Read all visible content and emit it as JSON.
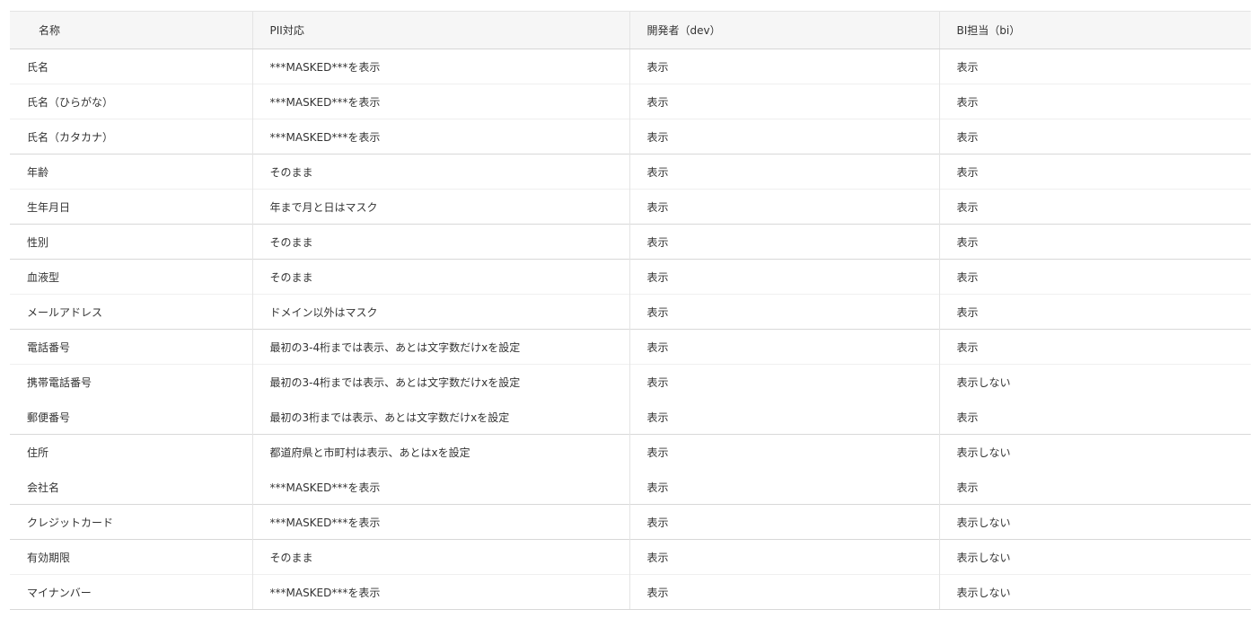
{
  "table": {
    "headers": [
      "名称",
      "PII対応",
      "開発者（dev）",
      "BI担当（bi）"
    ],
    "rows": [
      {
        "name": "氏名",
        "pii": "***MASKED***を表示",
        "dev": "表示",
        "bi": "表示",
        "sep": "strong"
      },
      {
        "name": "氏名（ひらがな）",
        "pii": "***MASKED***を表示",
        "dev": "表示",
        "bi": "表示",
        "sep": "light"
      },
      {
        "name": "氏名（カタカナ）",
        "pii": "***MASKED***を表示",
        "dev": "表示",
        "bi": "表示",
        "sep": "light"
      },
      {
        "name": "年齢",
        "pii": "そのまま",
        "dev": "表示",
        "bi": "表示",
        "sep": "strong"
      },
      {
        "name": "生年月日",
        "pii": "年まで月と日はマスク",
        "dev": "表示",
        "bi": "表示",
        "sep": "light"
      },
      {
        "name": "性別",
        "pii": "そのまま",
        "dev": "表示",
        "bi": "表示",
        "sep": "strong"
      },
      {
        "name": "血液型",
        "pii": "そのまま",
        "dev": "表示",
        "bi": "表示",
        "sep": "strong"
      },
      {
        "name": "メールアドレス",
        "pii": "ドメイン以外はマスク",
        "dev": "表示",
        "bi": "表示",
        "sep": "light"
      },
      {
        "name": "電話番号",
        "pii": "最初の3-4桁までは表示、あとは文字数だけxを設定",
        "dev": "表示",
        "bi": "表示",
        "sep": "strong"
      },
      {
        "name": "携帯電話番号",
        "pii": "最初の3-4桁までは表示、あとは文字数だけxを設定",
        "dev": "表示",
        "bi": "表示しない",
        "sep": "light"
      },
      {
        "name": "郵便番号",
        "pii": "最初の3桁までは表示、あとは文字数だけxを設定",
        "dev": "表示",
        "bi": "表示",
        "sep": "none"
      },
      {
        "name": "住所",
        "pii": "都道府県と市町村は表示、あとはxを設定",
        "dev": "表示",
        "bi": "表示しない",
        "sep": "strong"
      },
      {
        "name": "会社名",
        "pii": "***MASKED***を表示",
        "dev": "表示",
        "bi": "表示",
        "sep": "none"
      },
      {
        "name": "クレジットカード",
        "pii": "***MASKED***を表示",
        "dev": "表示",
        "bi": "表示しない",
        "sep": "strong"
      },
      {
        "name": "有効期限",
        "pii": "そのまま",
        "dev": "表示",
        "bi": "表示しない",
        "sep": "strong"
      },
      {
        "name": "マイナンバー",
        "pii": "***MASKED***を表示",
        "dev": "表示",
        "bi": "表示しない",
        "sep": "light"
      }
    ]
  }
}
